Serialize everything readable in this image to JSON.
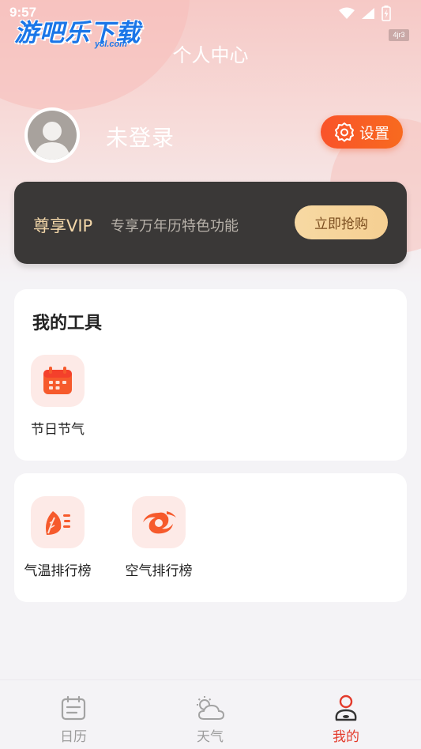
{
  "status_bar": {
    "time": "9:57"
  },
  "watermark": {
    "main": "游吧乐下载",
    "sub": "y8l.com",
    "tag": "4jr3"
  },
  "header": {
    "title": "个人中心"
  },
  "profile": {
    "username": "未登录",
    "settings_label": "设置"
  },
  "vip": {
    "title": "尊享VIP",
    "description": "专享万年历特色功能",
    "button_label": "立即抢购"
  },
  "tools_section": {
    "title": "我的工具",
    "items": [
      {
        "label": "节日节气",
        "icon": "calendar-icon"
      }
    ]
  },
  "ranking_section": {
    "items": [
      {
        "label": "气温排行榜",
        "icon": "leaf-icon"
      },
      {
        "label": "空气排行榜",
        "icon": "typhoon-icon"
      }
    ]
  },
  "tabbar": {
    "items": [
      {
        "label": "日历",
        "icon": "calendar-icon",
        "active": false
      },
      {
        "label": "天气",
        "icon": "weather-icon",
        "active": false
      },
      {
        "label": "我的",
        "icon": "profile-icon",
        "active": true
      }
    ]
  },
  "colors": {
    "accent": "#f9532a",
    "active_tab": "#e33a2b",
    "vip_bg": "#3a3837",
    "vip_gold": "#f3d7a9"
  }
}
